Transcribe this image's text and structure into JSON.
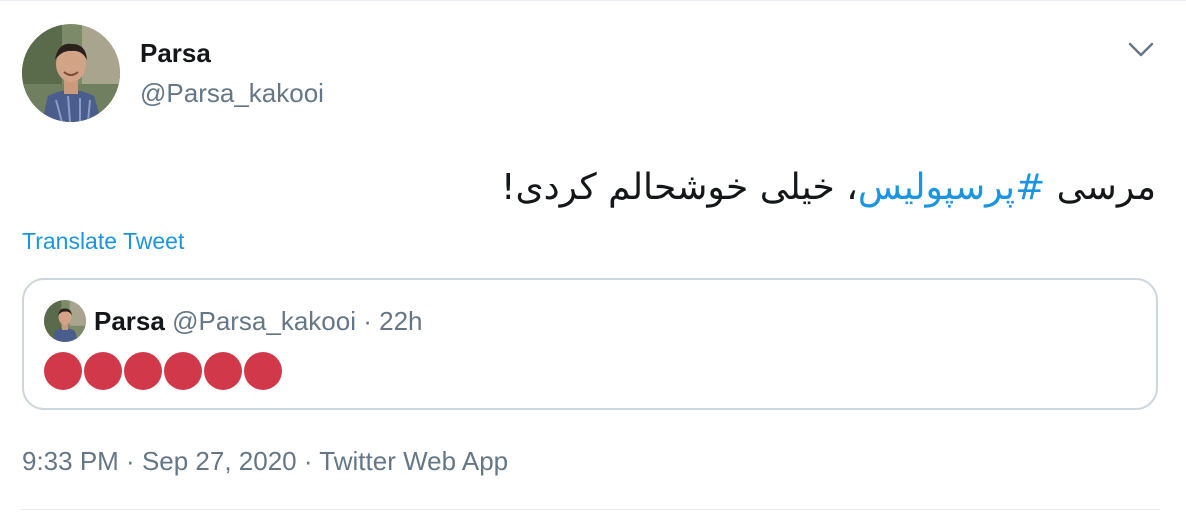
{
  "author": {
    "display_name": "Parsa",
    "handle": "@Parsa_kakooi"
  },
  "icons": {
    "more": "chevron-down-icon"
  },
  "tweet": {
    "text_before": "مرسی ",
    "hashtag": "#پرسپولیس",
    "text_after": "، خیلی خوشحالم کردی!",
    "translate_label": "Translate Tweet"
  },
  "quoted_tweet": {
    "display_name": "Parsa",
    "handle": "@Parsa_kakooi",
    "separator": " · ",
    "time_ago": "22h",
    "emoji_name": "red-circle",
    "emoji_count": 6
  },
  "meta": {
    "time": "9:33 PM",
    "separator": " · ",
    "date": "Sep 27, 2020",
    "source": "Twitter Web App"
  },
  "colors": {
    "accent": "#1b95e0",
    "text_primary": "#14171a",
    "text_secondary": "#657786",
    "border": "#ccd6dd",
    "red_circle": "#d1394a"
  }
}
